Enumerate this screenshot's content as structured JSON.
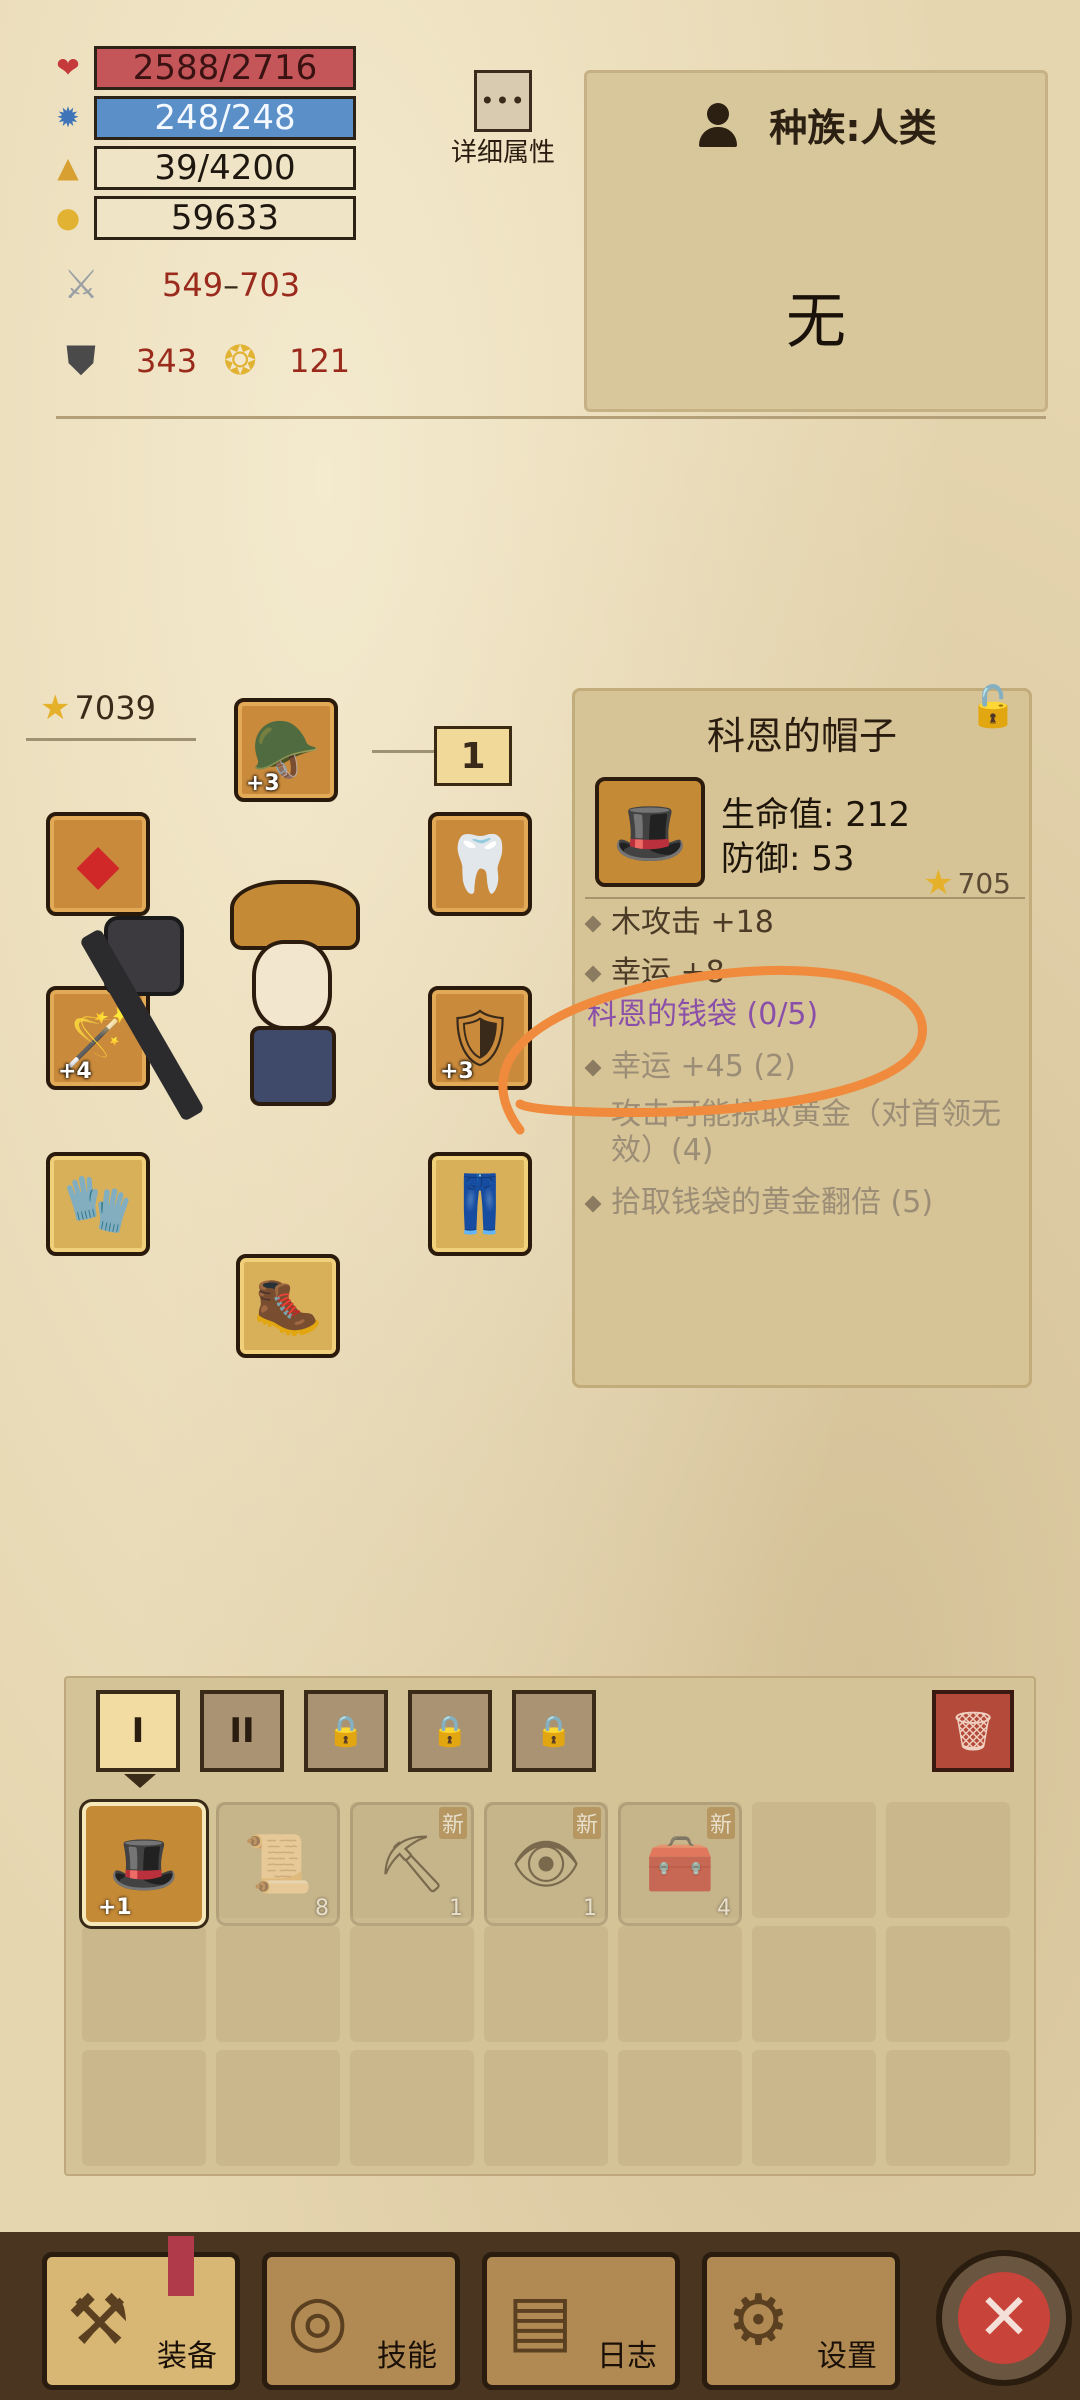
{
  "stats": {
    "hp": "2588/2716",
    "mp": "248/248",
    "exp": "39/4200",
    "gold": "59633",
    "attack_min": "549",
    "attack_sep": "–",
    "attack_max": "703",
    "defense": "343",
    "luck": "121",
    "icons": {
      "hp": "heart-icon",
      "mp": "gear-icon",
      "exp": "triangle-icon",
      "gold": "coin-pile-icon",
      "attack": "crossed-swords-icon",
      "defense": "shield-icon",
      "luck": "lucky-coin-icon"
    }
  },
  "details_button": {
    "label": "详细属性",
    "glyph": "•••"
  },
  "race_panel": {
    "title": "种族:人类",
    "value": "无"
  },
  "equipment": {
    "power": "7039",
    "level": "1",
    "slots": [
      {
        "name": "helmet",
        "badge": "+3"
      },
      {
        "name": "ring",
        "badge": ""
      },
      {
        "name": "amulet",
        "badge": ""
      },
      {
        "name": "weapon",
        "badge": "+4"
      },
      {
        "name": "armor",
        "badge": "+3"
      },
      {
        "name": "bracer",
        "badge": ""
      },
      {
        "name": "pants",
        "badge": ""
      },
      {
        "name": "boots",
        "badge": ""
      }
    ]
  },
  "tooltip": {
    "title": "科恩的帽子",
    "hp_stat": "生命值: 212",
    "def_stat": "防御: 53",
    "power": "705",
    "attr1": "木攻击 +18",
    "attr2": "幸运 +8",
    "set_name": "科恩的钱袋 (0/5)",
    "set1": "幸运 +45 (2)",
    "set2": "攻击可能掠取黄金（对首领无效）(4)",
    "set3": "拾取钱袋的黄金翻倍 (5)"
  },
  "inventory": {
    "tabs": [
      "I",
      "II",
      "🔒",
      "🔒",
      "🔒"
    ],
    "items": [
      {
        "name": "hat",
        "plus": "+1",
        "count": "",
        "new": ""
      },
      {
        "name": "scroll",
        "plus": "",
        "count": "8",
        "new": ""
      },
      {
        "name": "pickaxe",
        "plus": "",
        "count": "1",
        "new": "新"
      },
      {
        "name": "eye-scroll",
        "plus": "",
        "count": "1",
        "new": "新"
      },
      {
        "name": "chest",
        "plus": "",
        "count": "4",
        "new": "新"
      }
    ]
  },
  "nav": {
    "equip": "装备",
    "skills": "技能",
    "log": "日志",
    "settings": "设置",
    "close": "✕"
  }
}
